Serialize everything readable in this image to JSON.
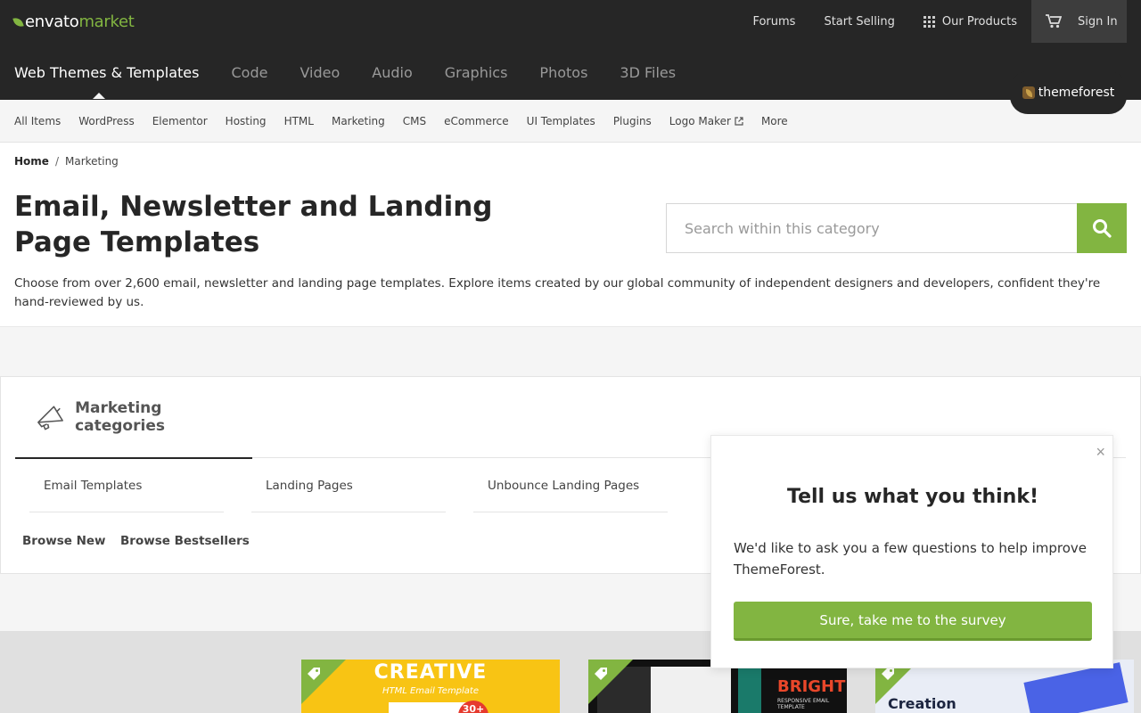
{
  "logo": {
    "part1": "envato",
    "part2": "market"
  },
  "topnav": {
    "forums": "Forums",
    "start_selling": "Start Selling",
    "our_products": "Our Products",
    "sign_in": "Sign In"
  },
  "categories": [
    "Web Themes & Templates",
    "Code",
    "Video",
    "Audio",
    "Graphics",
    "Photos",
    "3D Files"
  ],
  "badge": "themeforest",
  "subnav": [
    "All Items",
    "WordPress",
    "Elementor",
    "Hosting",
    "HTML",
    "Marketing",
    "CMS",
    "eCommerce",
    "UI Templates",
    "Plugins",
    "Logo Maker",
    "More"
  ],
  "breadcrumb": {
    "home": "Home",
    "sep": "/",
    "current": "Marketing"
  },
  "page_title": "Email, Newsletter and Landing Page Templates",
  "search": {
    "placeholder": "Search within this category"
  },
  "description": "Choose from over 2,600 email, newsletter and landing page templates. Explore items created by our global community of independent designers and developers, confident they're hand-reviewed by us.",
  "marketing": {
    "title": "Marketing categories",
    "items": [
      "Email Templates",
      "Landing Pages",
      "Unbounce Landing Pages"
    ],
    "browse_new": "Browse New",
    "browse_bestsellers": "Browse Bestsellers"
  },
  "thumbs": [
    {
      "title": "CREATIVE",
      "subtitle": "HTML Email Template",
      "badge": "30+"
    },
    {
      "title": "BRIGHT",
      "subtitle": "RESPONSIVE EMAIL TEMPLATE"
    },
    {
      "title": "Creation"
    }
  ],
  "survey": {
    "close": "×",
    "title": "Tell us what you think!",
    "body": "We'd like to ask you a few questions to help improve ThemeForest.",
    "cta": "Sure, take me to the survey"
  },
  "colors": {
    "brand_green": "#82b541",
    "dark_bar": "#262626"
  }
}
